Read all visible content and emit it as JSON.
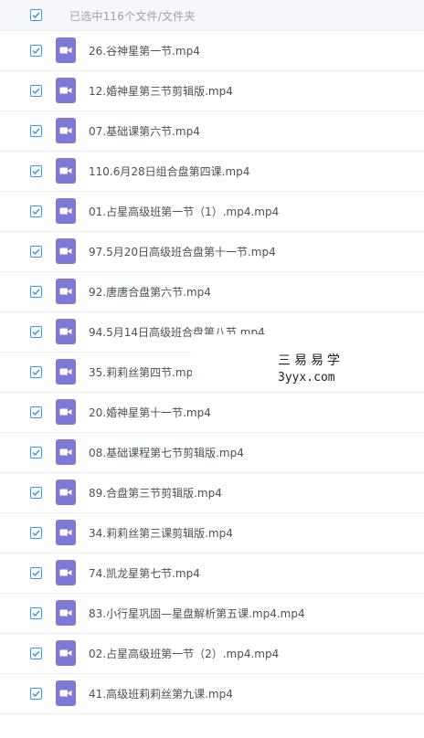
{
  "header": {
    "selection_text": "已选中116个文件/文件夹",
    "select_all_checked": true
  },
  "colors": {
    "checkbox_border": "#3e9ae8",
    "video_icon": "#7f79d6",
    "file_text": "#4a5159"
  },
  "icons": {
    "checkbox": "checkmark-icon",
    "file": "video-file-icon"
  },
  "files": [
    {
      "name": "26.谷神星第一节.mp4",
      "checked": true
    },
    {
      "name": "12.婚神星第三节剪辑版.mp4",
      "checked": true
    },
    {
      "name": "07.基础课第六节.mp4",
      "checked": true
    },
    {
      "name": "110.6月28日组合盘第四课.mp4",
      "checked": true
    },
    {
      "name": "01.占星高级班第一节（1）.mp4.mp4",
      "checked": true
    },
    {
      "name": "97.5月20日高级班合盘第十一节.mp4",
      "checked": true
    },
    {
      "name": "92.唐唐合盘第六节.mp4",
      "checked": true
    },
    {
      "name": "94.5月14日高级班合盘第八节.mp4",
      "checked": true
    },
    {
      "name": "35.莉莉丝第四节.mp4",
      "checked": true
    },
    {
      "name": "20.婚神星第十一节.mp4",
      "checked": true
    },
    {
      "name": "08.基础课程第七节剪辑版.mp4",
      "checked": true
    },
    {
      "name": "89.合盘第三节剪辑版.mp4",
      "checked": true
    },
    {
      "name": "34.莉莉丝第三课剪辑版.mp4",
      "checked": true
    },
    {
      "name": "74.凯龙星第七节.mp4",
      "checked": true
    },
    {
      "name": "83.小行星巩固—星盘解析第五课.mp4.mp4",
      "checked": true
    },
    {
      "name": "02.占星高级班第一节（2）.mp4.mp4",
      "checked": true
    },
    {
      "name": "41.高级班莉莉丝第九课.mp4",
      "checked": true
    }
  ],
  "watermark": {
    "title": "三易易学",
    "url": "3yyx.com"
  }
}
